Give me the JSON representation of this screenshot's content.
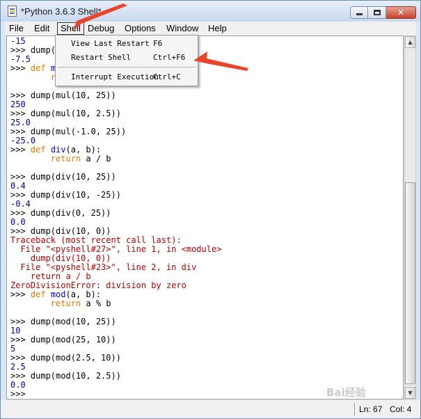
{
  "window": {
    "title": "*Python 3.6.3 Shell*",
    "controls": {
      "minimize": "minimize",
      "maximize": "maximize",
      "close": "✕"
    }
  },
  "menubar": {
    "items": [
      {
        "label": "File"
      },
      {
        "label": "Edit"
      },
      {
        "label": "Shell"
      },
      {
        "label": "Debug"
      },
      {
        "label": "Options"
      },
      {
        "label": "Window"
      },
      {
        "label": "Help"
      }
    ],
    "active": "Shell"
  },
  "shell_menu": {
    "items": [
      {
        "label": "View Last Restart",
        "accel": "F6"
      },
      {
        "label": "Restart Shell",
        "accel": "Ctrl+F6"
      },
      {
        "label": "Interrupt Execution",
        "accel": "Ctrl+C"
      }
    ]
  },
  "editor": {
    "lines": [
      [
        {
          "t": "-15",
          "c": "out"
        }
      ],
      [
        {
          "t": ">>> ",
          "c": "prompt"
        },
        {
          "t": "dump(",
          "c": "plain"
        }
      ],
      [
        {
          "t": "-7.5",
          "c": "out"
        }
      ],
      [
        {
          "t": ">>> ",
          "c": "prompt"
        },
        {
          "t": "def ",
          "c": "kw"
        },
        {
          "t": "m",
          "c": "def"
        }
      ],
      [
        {
          "t": "        r",
          "c": "kw"
        }
      ],
      [
        {
          "t": "",
          "c": "plain"
        }
      ],
      [
        {
          "t": ">>> ",
          "c": "prompt"
        },
        {
          "t": "dump(mul(10, 25))",
          "c": "plain"
        }
      ],
      [
        {
          "t": "250",
          "c": "out"
        }
      ],
      [
        {
          "t": ">>> ",
          "c": "prompt"
        },
        {
          "t": "dump(mul(10, 2.5))",
          "c": "plain"
        }
      ],
      [
        {
          "t": "25.0",
          "c": "out"
        }
      ],
      [
        {
          "t": ">>> ",
          "c": "prompt"
        },
        {
          "t": "dump(mul(-1.0, 25))",
          "c": "plain"
        }
      ],
      [
        {
          "t": "-25.0",
          "c": "out"
        }
      ],
      [
        {
          "t": ">>> ",
          "c": "prompt"
        },
        {
          "t": "def ",
          "c": "kw"
        },
        {
          "t": "div",
          "c": "def"
        },
        {
          "t": "(a, b):",
          "c": "plain"
        }
      ],
      [
        {
          "t": "        ",
          "c": "plain"
        },
        {
          "t": "return",
          "c": "kw"
        },
        {
          "t": " a / b",
          "c": "plain"
        }
      ],
      [
        {
          "t": "",
          "c": "plain"
        }
      ],
      [
        {
          "t": ">>> ",
          "c": "prompt"
        },
        {
          "t": "dump(div(10, 25))",
          "c": "plain"
        }
      ],
      [
        {
          "t": "0.4",
          "c": "out"
        }
      ],
      [
        {
          "t": ">>> ",
          "c": "prompt"
        },
        {
          "t": "dump(div(10, -25))",
          "c": "plain"
        }
      ],
      [
        {
          "t": "-0.4",
          "c": "out"
        }
      ],
      [
        {
          "t": ">>> ",
          "c": "prompt"
        },
        {
          "t": "dump(div(0, 25))",
          "c": "plain"
        }
      ],
      [
        {
          "t": "0.0",
          "c": "out"
        }
      ],
      [
        {
          "t": ">>> ",
          "c": "prompt"
        },
        {
          "t": "dump(div(10, 0))",
          "c": "plain"
        }
      ],
      [
        {
          "t": "Traceback (most recent call last):",
          "c": "err"
        }
      ],
      [
        {
          "t": "  File \"<pyshell#27>\", line 1, in <module>",
          "c": "err"
        }
      ],
      [
        {
          "t": "    dump(div(10, 0))",
          "c": "err"
        }
      ],
      [
        {
          "t": "  File \"<pyshell#23>\", line 2, in div",
          "c": "err"
        }
      ],
      [
        {
          "t": "    return a / b",
          "c": "err"
        }
      ],
      [
        {
          "t": "ZeroDivisionError: division by zero",
          "c": "err"
        }
      ],
      [
        {
          "t": ">>> ",
          "c": "prompt"
        },
        {
          "t": "def ",
          "c": "kw"
        },
        {
          "t": "mod",
          "c": "def"
        },
        {
          "t": "(a, b):",
          "c": "plain"
        }
      ],
      [
        {
          "t": "        ",
          "c": "plain"
        },
        {
          "t": "return",
          "c": "kw"
        },
        {
          "t": " a % b",
          "c": "plain"
        }
      ],
      [
        {
          "t": "",
          "c": "plain"
        }
      ],
      [
        {
          "t": ">>> ",
          "c": "prompt"
        },
        {
          "t": "dump(mod(10, 25))",
          "c": "plain"
        }
      ],
      [
        {
          "t": "10",
          "c": "out"
        }
      ],
      [
        {
          "t": ">>> ",
          "c": "prompt"
        },
        {
          "t": "dump(mod(25, 10))",
          "c": "plain"
        }
      ],
      [
        {
          "t": "5",
          "c": "out"
        }
      ],
      [
        {
          "t": ">>> ",
          "c": "prompt"
        },
        {
          "t": "dump(mod(2.5, 10))",
          "c": "plain"
        }
      ],
      [
        {
          "t": "2.5",
          "c": "out"
        }
      ],
      [
        {
          "t": ">>> ",
          "c": "prompt"
        },
        {
          "t": "dump(mod(10, 2.5))",
          "c": "plain"
        }
      ],
      [
        {
          "t": "0.0",
          "c": "out"
        }
      ],
      [
        {
          "t": ">>>",
          "c": "prompt"
        }
      ]
    ]
  },
  "status": {
    "line": "Ln: 67",
    "col": "Col: 4"
  },
  "watermark": "Bai经验",
  "colors": {
    "keyword": "#ff7700",
    "definition": "#0000ff",
    "output": "#0000c0",
    "error": "#c00000",
    "annotation_arrow": "#e8452c"
  }
}
